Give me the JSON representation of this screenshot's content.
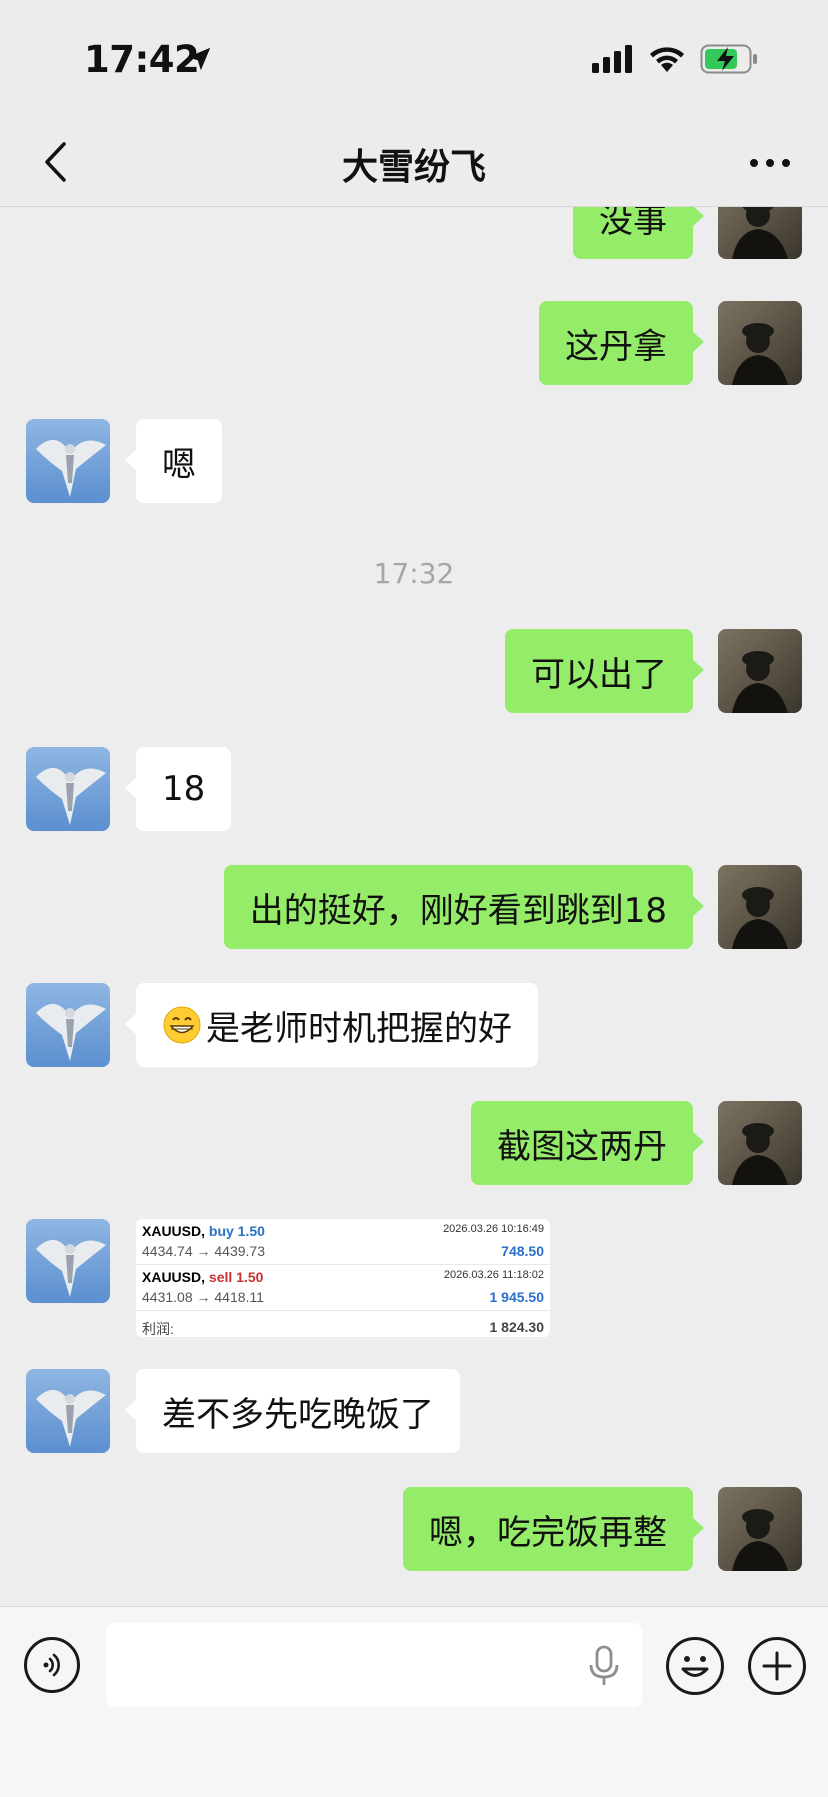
{
  "status_bar": {
    "time": "17:42",
    "location_icon": "location-arrow-icon",
    "signal_icon": "cellular-signal-icon",
    "wifi_icon": "wifi-icon",
    "battery_icon": "battery-charging-icon",
    "battery_color": "#34c759"
  },
  "header": {
    "back_icon": "chevron-left-icon",
    "title": "大雪纷飞",
    "more_icon": "more-dots-icon"
  },
  "colors": {
    "background": "#ededed",
    "outgoing_bubble": "#95ec69",
    "incoming_bubble": "#ffffff",
    "timestamp_text": "#a6a6a6"
  },
  "messages": [
    {
      "from": "me",
      "type": "text",
      "text": "没事"
    },
    {
      "from": "me",
      "type": "text",
      "text": "这丹拿"
    },
    {
      "from": "them",
      "type": "text",
      "text": "嗯"
    },
    {
      "type": "time",
      "text": "17:32"
    },
    {
      "from": "me",
      "type": "text",
      "text": "可以出了"
    },
    {
      "from": "them",
      "type": "text",
      "text": "18"
    },
    {
      "from": "me",
      "type": "text",
      "text": "出的挺好，刚好看到跳到18"
    },
    {
      "from": "them",
      "type": "text",
      "emoji": "grinning-face-icon",
      "text": "是老师时机把握的好"
    },
    {
      "from": "me",
      "type": "text",
      "text": "截图这两丹"
    },
    {
      "from": "them",
      "type": "image",
      "trades": [
        {
          "symbol": "XAUUSD,",
          "side": "buy 1.50",
          "datetime": "2026.03.26 10:16:49",
          "prices": "4434.74 → 4439.73",
          "profit": "748.50"
        },
        {
          "symbol": "XAUUSD,",
          "side": "sell 1.50",
          "datetime": "2026.03.26 11:18:02",
          "prices": "4431.08 → 4418.11",
          "profit": "1 945.50"
        }
      ],
      "total_label": "利润:",
      "total_value": "1 824.30"
    },
    {
      "from": "them",
      "type": "text",
      "text": "差不多先吃晚饭了"
    },
    {
      "from": "me",
      "type": "text",
      "text": "嗯，吃完饭再整"
    }
  ],
  "input_bar": {
    "voice_icon": "voice-input-icon",
    "placeholder": "",
    "mic_icon": "microphone-icon",
    "emoji_icon": "emoji-smile-icon",
    "plus_icon": "plus-circle-icon"
  }
}
